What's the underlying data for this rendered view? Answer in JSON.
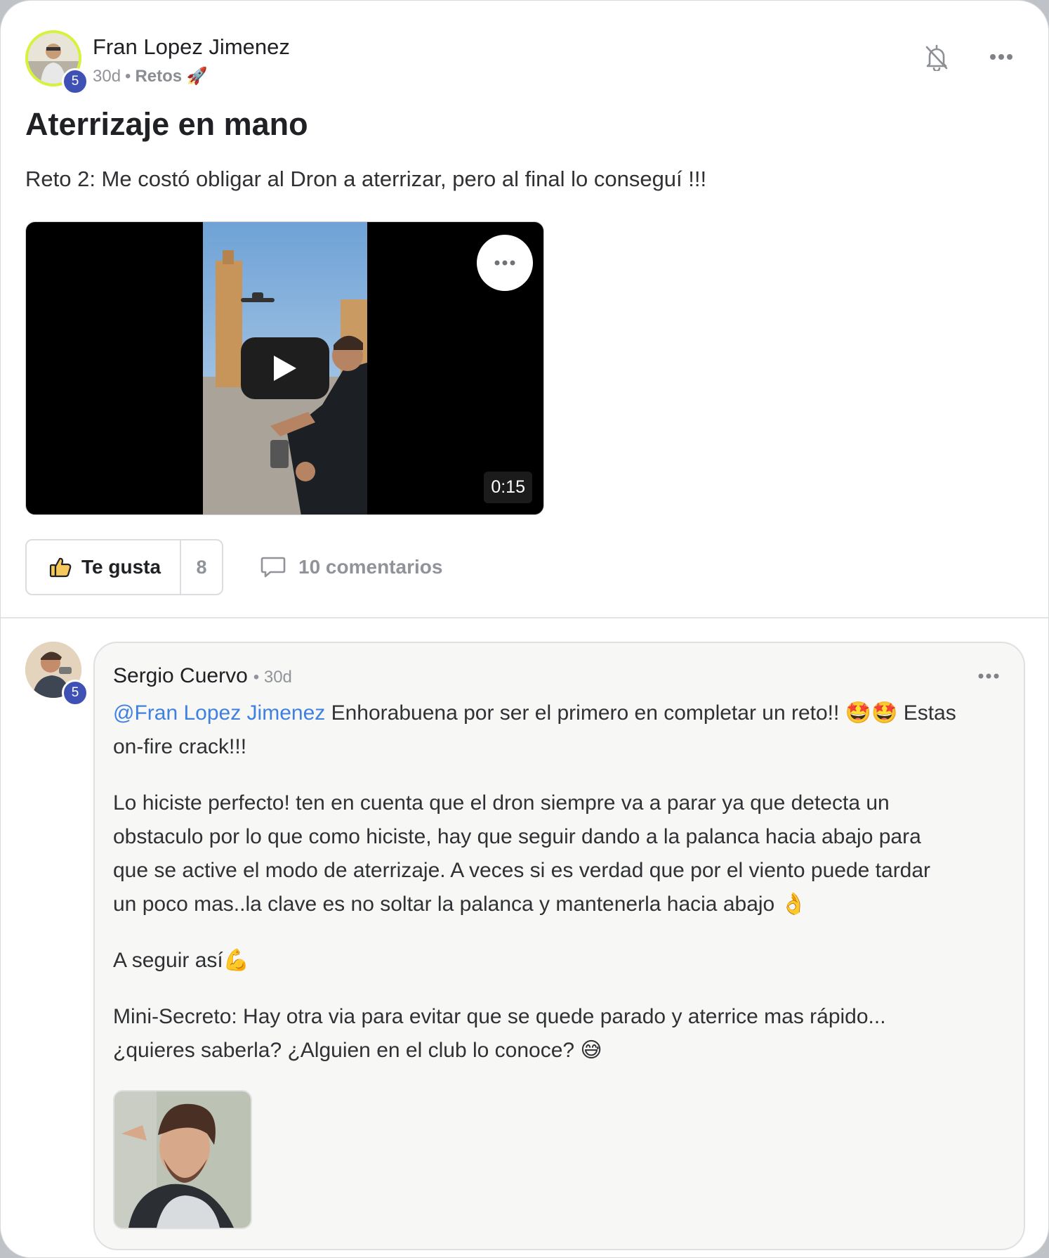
{
  "post": {
    "author": "Fran Lopez Jimenez",
    "level": "5",
    "time": "30d",
    "category": "Retos 🚀",
    "title": "Aterrizaje en mano",
    "body": "Reto 2: Me costó obligar al Dron a aterrizar, pero al final lo conseguí !!!",
    "video": {
      "duration": "0:15"
    },
    "like_label": "Te gusta",
    "like_count": "8",
    "comments_label": "10 comentarios"
  },
  "comment": {
    "author": "Sergio Cuervo",
    "level": "5",
    "time": "30d",
    "mention": "@Fran Lopez Jimenez",
    "line1_rest": " Enhorabuena por ser el primero en completar un reto!! 🤩🤩 Estas",
    "line2": "on-fire crack!!!",
    "para2_lines": [
      "Lo hiciste perfecto! ten en cuenta que el dron siempre va a parar ya que detecta un",
      "obstaculo por lo que como hiciste, hay que seguir dando a la palanca hacia abajo para",
      "que se active el modo de aterrizaje. A veces si es verdad que por el viento puede tardar",
      "un poco mas..la clave es no soltar la palanca y mantenerla hacia abajo 👌"
    ],
    "para3": "A seguir así💪",
    "para4_lines": [
      "Mini-Secreto: Hay otra via para evitar que se quede parado y aterrice mas rápido...",
      "¿quieres saberla? ¿Alguien en el club lo conoce? 😅"
    ]
  },
  "icons": {
    "bell": "bell-off-icon",
    "more": "more-horizontal-icon",
    "like": "thumbs-up-icon",
    "comment": "comment-bubble-icon",
    "play": "play-icon"
  },
  "colors": {
    "level_badge": "#3f51b5",
    "mention": "#3f80e0",
    "avatar_ring": "#d7f23a"
  }
}
